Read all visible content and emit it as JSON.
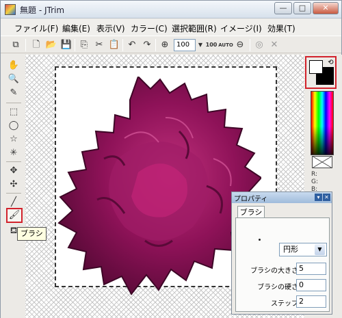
{
  "window": {
    "title": "無題 - JTrim",
    "minimize_glyph": "—",
    "maximize_glyph": "□",
    "close_glyph": "✕"
  },
  "menu": [
    {
      "label": "ファイル(F)"
    },
    {
      "label": "編集(E)"
    },
    {
      "label": "表示(V)"
    },
    {
      "label": "カラー(C)"
    },
    {
      "label": "選択範囲(R)"
    },
    {
      "label": "イメージ(I)"
    },
    {
      "label": "効果(T)"
    }
  ],
  "toolbar": {
    "zoom_value": "100",
    "zoom_100_label": "100",
    "zoom_auto_label": "AUTO",
    "icons": [
      "properties-icon",
      "new-file-icon",
      "open-folder-icon",
      "save-icon",
      "copy-icon",
      "cut-icon",
      "paste-icon",
      "undo-icon",
      "redo-icon",
      "zoom-in-icon",
      "zoom-dropdown-icon",
      "zoom-100-icon",
      "zoom-auto-icon",
      "zoom-out-icon",
      "stop-icon",
      "cancel-icon"
    ]
  },
  "tools": [
    {
      "name": "hand-tool-icon"
    },
    {
      "name": "magnifier-tool-icon"
    },
    {
      "name": "eyedropper-tool-icon"
    },
    {
      "name": "rect-select-tool-icon"
    },
    {
      "name": "ellipse-select-tool-icon"
    },
    {
      "name": "lasso-tool-icon"
    },
    {
      "name": "magic-wand-tool-icon"
    },
    {
      "name": "move-tool-icon"
    },
    {
      "name": "copy-move-tool-icon"
    },
    {
      "name": "pencil-tool-icon"
    },
    {
      "name": "brush-tool-icon",
      "selected": true
    },
    {
      "name": "fill-tool-icon"
    }
  ],
  "tooltip": {
    "text": "ブラシ"
  },
  "colors": {
    "foreground": "#ffffff",
    "background": "#000000",
    "highlight": "#d2212b",
    "flower_main": "#8e1258",
    "flower_light": "#b42a78",
    "flower_dark": "#5a0a38"
  },
  "color_panel": {
    "r_label": "R:",
    "g_label": "G:",
    "b_label": "B:"
  },
  "properties": {
    "title": "プロパティ",
    "tab": "ブラシ",
    "shape_value": "円形",
    "size_label": "ブラシの大きさ",
    "size_value": "5",
    "hardness_label": "ブラシの硬さ",
    "hardness_value": "0",
    "step_label": "ステップ",
    "step_value": "2"
  }
}
